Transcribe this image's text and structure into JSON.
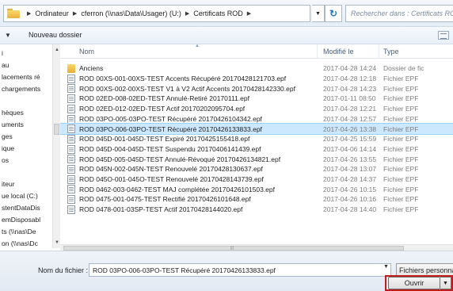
{
  "address_bar": {
    "crumbs": [
      "Ordinateur",
      "cferron (\\\\nas\\Data\\Usager) (U:)",
      "Certificats ROD"
    ],
    "search_placeholder": "Rechercher dans : Certificats ROD"
  },
  "toolbar": {
    "new_folder_label": "Nouveau dossier"
  },
  "nav_pane": {
    "items": [
      "i",
      "au",
      "lacements ré",
      "chargements",
      "",
      "hèques",
      "uments",
      "ges",
      "ique",
      "os",
      "",
      "iteur",
      "ue local (C:)",
      "stentDataDis",
      "emDisposabl",
      "ts (\\\\nas\\De",
      "on (\\\\nas\\Dc"
    ]
  },
  "file_list": {
    "columns": {
      "name": "Nom",
      "modified": "Modifié le",
      "type": "Type"
    },
    "rows": [
      {
        "name": "Anciens",
        "modified": "2017-04-28 14:24",
        "type": "Dossier de fic",
        "kind": "folder",
        "selected": false
      },
      {
        "name": "ROD 00XS-001-00XS-TEST Accents Récupéré 20170428121703.epf",
        "modified": "2017-04-28 12:18",
        "type": "Fichier EPF",
        "kind": "file",
        "selected": false
      },
      {
        "name": "ROD 00XS-002-00XS-TEST V1 à V2 Actif Accents 20170428142330.epf",
        "modified": "2017-04-28 14:23",
        "type": "Fichier EPF",
        "kind": "file",
        "selected": false
      },
      {
        "name": "ROD 02ED-008-02ED-TEST Annulé-Retiré 20170111.epf",
        "modified": "2017-01-11 08:50",
        "type": "Fichier EPF",
        "kind": "file",
        "selected": false
      },
      {
        "name": "ROD 02ED-012-02ED-TEST Actif 20170202095704.epf",
        "modified": "2017-04-28 12:21",
        "type": "Fichier EPF",
        "kind": "file",
        "selected": false
      },
      {
        "name": "ROD 03PO-005-03PO-TEST Récupéré 20170426104342.epf",
        "modified": "2017-04-28 12:57",
        "type": "Fichier EPF",
        "kind": "file",
        "selected": false
      },
      {
        "name": "ROD 03PO-006-03PO-TEST Récupéré 20170426133833.epf",
        "modified": "2017-04-26 13:38",
        "type": "Fichier EPF",
        "kind": "file",
        "selected": true
      },
      {
        "name": "ROD 045D-001-045D-TEST Expiré 20170425155418.epf",
        "modified": "2017-04-25 15:59",
        "type": "Fichier EPF",
        "kind": "file",
        "selected": false
      },
      {
        "name": "ROD 045D-004-045D-TEST Suspendu 20170406141439.epf",
        "modified": "2017-04-06 14:14",
        "type": "Fichier EPF",
        "kind": "file",
        "selected": false
      },
      {
        "name": "ROD 045D-005-045D-TEST Annulé-Révoqué 20170426134821.epf",
        "modified": "2017-04-26 13:55",
        "type": "Fichier EPF",
        "kind": "file",
        "selected": false
      },
      {
        "name": "ROD 045N-002-045N-TEST Renouvelé 20170428130637.epf",
        "modified": "2017-04-28 13:07",
        "type": "Fichier EPF",
        "kind": "file",
        "selected": false
      },
      {
        "name": "ROD 045O-001-045O-TEST Renouvelé 20170428143739.epf",
        "modified": "2017-04-28 14:37",
        "type": "Fichier EPF",
        "kind": "file",
        "selected": false
      },
      {
        "name": "ROD 0462-003-0462-TEST MAJ complétée 20170426101503.epf",
        "modified": "2017-04-26 10:15",
        "type": "Fichier EPF",
        "kind": "file",
        "selected": false
      },
      {
        "name": "ROD 0475-001-0475-TEST Rectifié 20170426101648.epf",
        "modified": "2017-04-26 10:16",
        "type": "Fichier EPF",
        "kind": "file",
        "selected": false
      },
      {
        "name": "ROD 0478-001-03SP-TEST Actif 20170428144020.epf",
        "modified": "2017-04-28 14:40",
        "type": "Fichier EPF",
        "kind": "file",
        "selected": false
      }
    ]
  },
  "footer": {
    "filename_label": "Nom du fichier :",
    "filename_value": "ROD 03PO-006-03PO-TEST Récupéré 20170426133833.epf",
    "filetype_value": "Fichiers personnalisés",
    "open_label": "Ouvrir"
  }
}
